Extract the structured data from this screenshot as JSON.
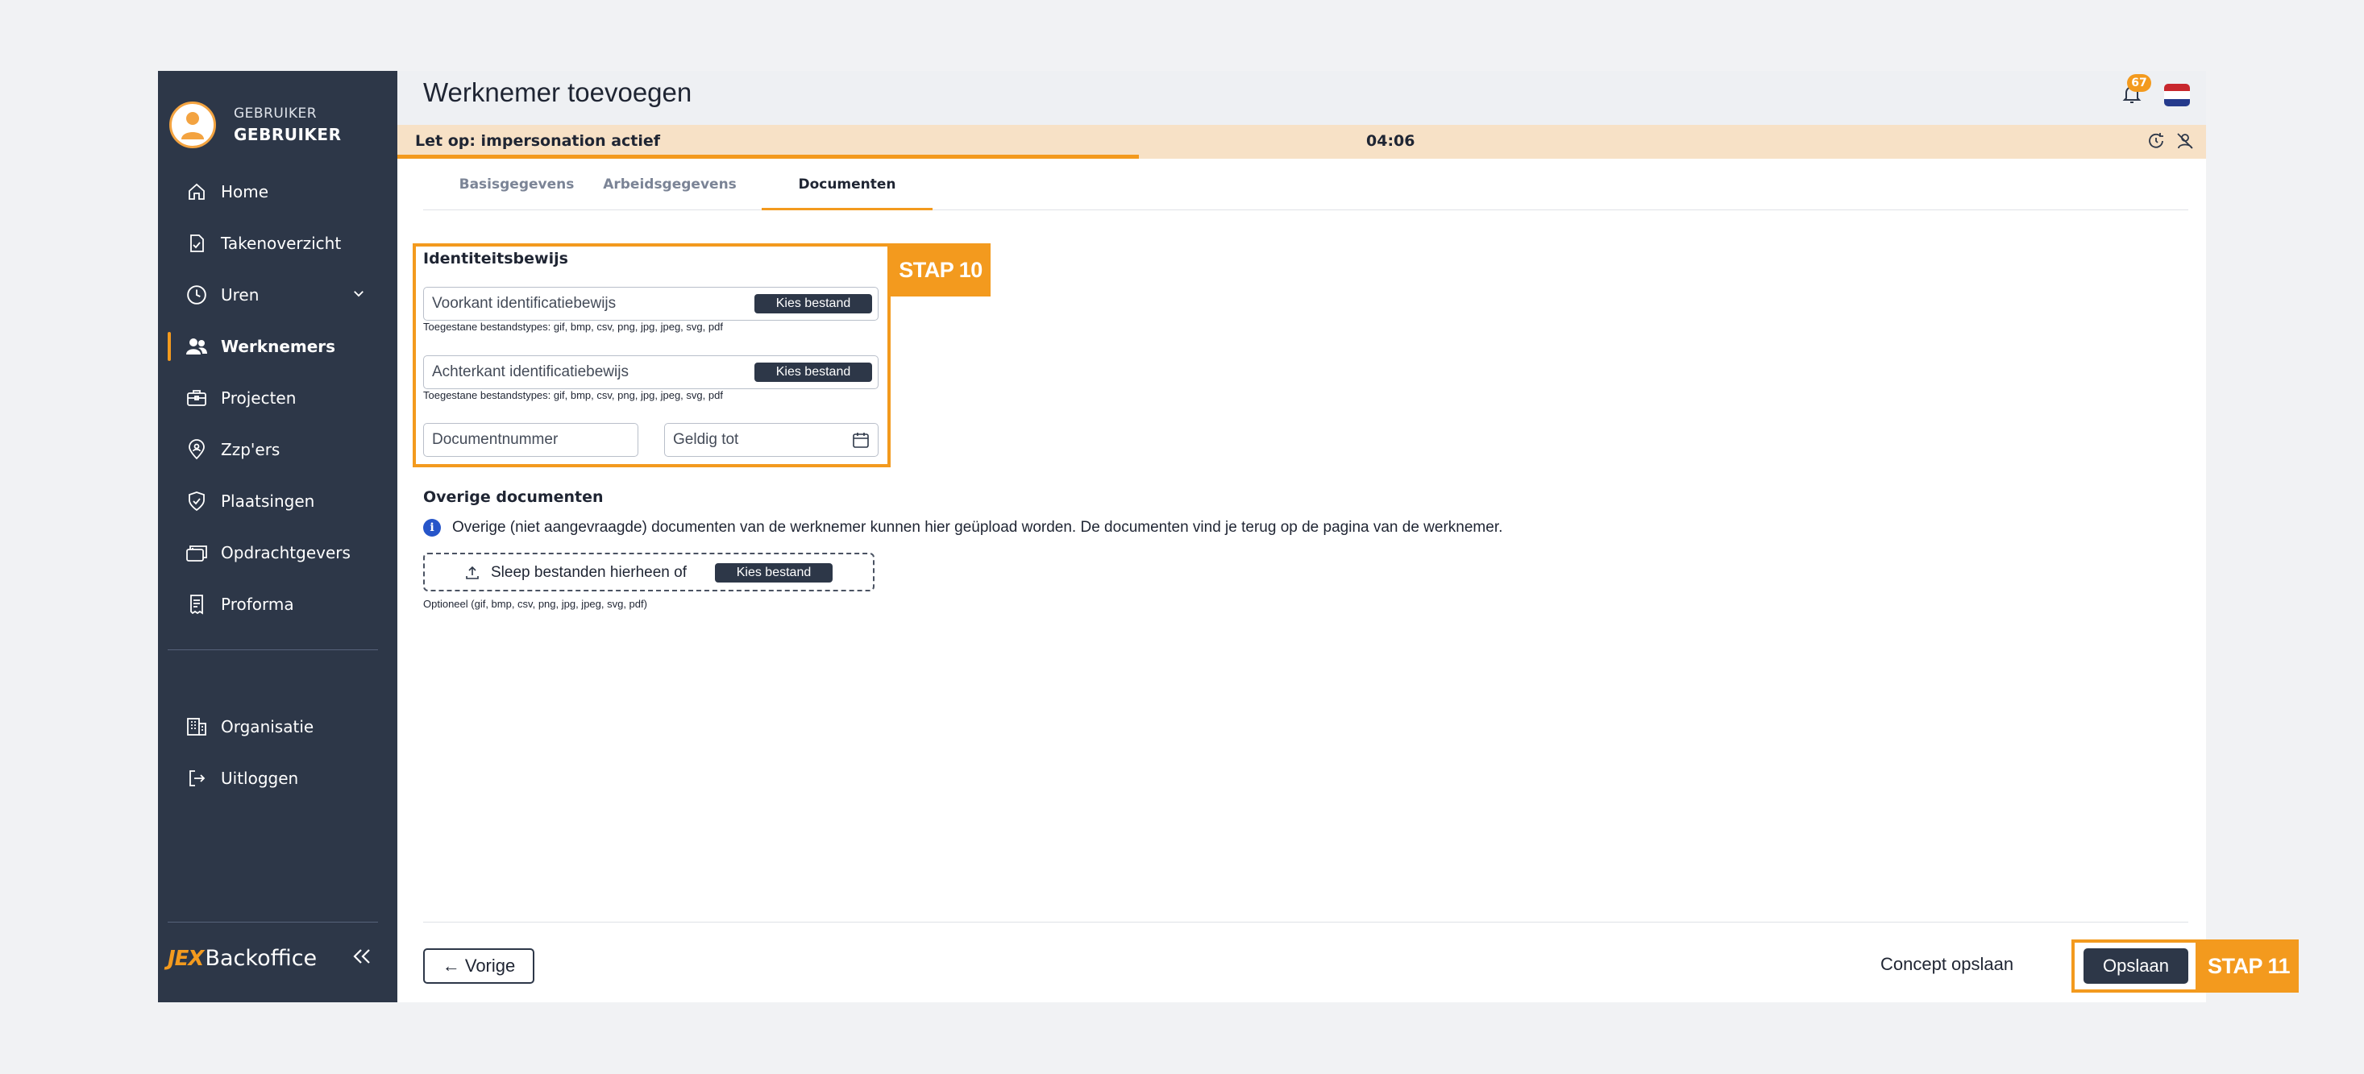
{
  "user": {
    "role": "GEBRUIKER",
    "name": "GEBRUIKER"
  },
  "nav": [
    {
      "label": "Home",
      "icon": "home-icon"
    },
    {
      "label": "Takenoverzicht",
      "icon": "task-list-icon"
    },
    {
      "label": "Uren",
      "icon": "clock-icon"
    },
    {
      "label": "Werknemers",
      "icon": "users-icon",
      "active": true
    },
    {
      "label": "Projecten",
      "icon": "briefcase-icon"
    },
    {
      "label": "Zzp'ers",
      "icon": "location-pin-icon"
    },
    {
      "label": "Plaatsingen",
      "icon": "shield-check-icon"
    },
    {
      "label": "Opdrachtgevers",
      "icon": "client-icon"
    },
    {
      "label": "Proforma",
      "icon": "receipt-icon"
    },
    {
      "label": "Organisatie",
      "icon": "building-icon"
    },
    {
      "label": "Uitloggen",
      "icon": "logout-icon"
    }
  ],
  "brand": {
    "mark": "JEX",
    "name": "Backoffice"
  },
  "header": {
    "title": "Werknemer toevoegen",
    "notification_count": "67"
  },
  "impersonation": {
    "text": "Let op: impersonation actief",
    "timer": "04:06",
    "progress": 0.41
  },
  "tabs": [
    {
      "label": "Basisgegevens"
    },
    {
      "label": "Arbeidsgegevens"
    },
    {
      "label": "Documenten",
      "active": true
    }
  ],
  "identity": {
    "title": "Identiteitsbewijs",
    "front_label": "Voorkant identificatiebewijs",
    "back_label": "Achterkant identificatiebewijs",
    "choose_file": "Kies bestand",
    "allowed_types": "Toegestane bestandstypes: gif, bmp, csv, png, jpg, jpeg, svg, pdf",
    "document_number": "Documentnummer",
    "valid_until": "Geldig tot"
  },
  "other_docs": {
    "title": "Overige documenten",
    "info": "Overige (niet aangevraagde) documenten van de werknemer kunnen hier geüpload worden. De documenten vind je terug op de pagina van de werknemer.",
    "drop_text": "Sleep bestanden hierheen of",
    "choose_file": "Kies bestand",
    "optional": "Optioneel (gif, bmp, csv, png, jpg, jpeg, svg, pdf)"
  },
  "footer": {
    "back": "Vorige",
    "concept": "Concept opslaan",
    "save": "Opslaan"
  },
  "steps": {
    "step10": "STAP 10",
    "step11": "STAP 11"
  },
  "colors": {
    "accent": "#f39a1e",
    "sidebar": "#2d3748",
    "info": "#2655c9"
  }
}
